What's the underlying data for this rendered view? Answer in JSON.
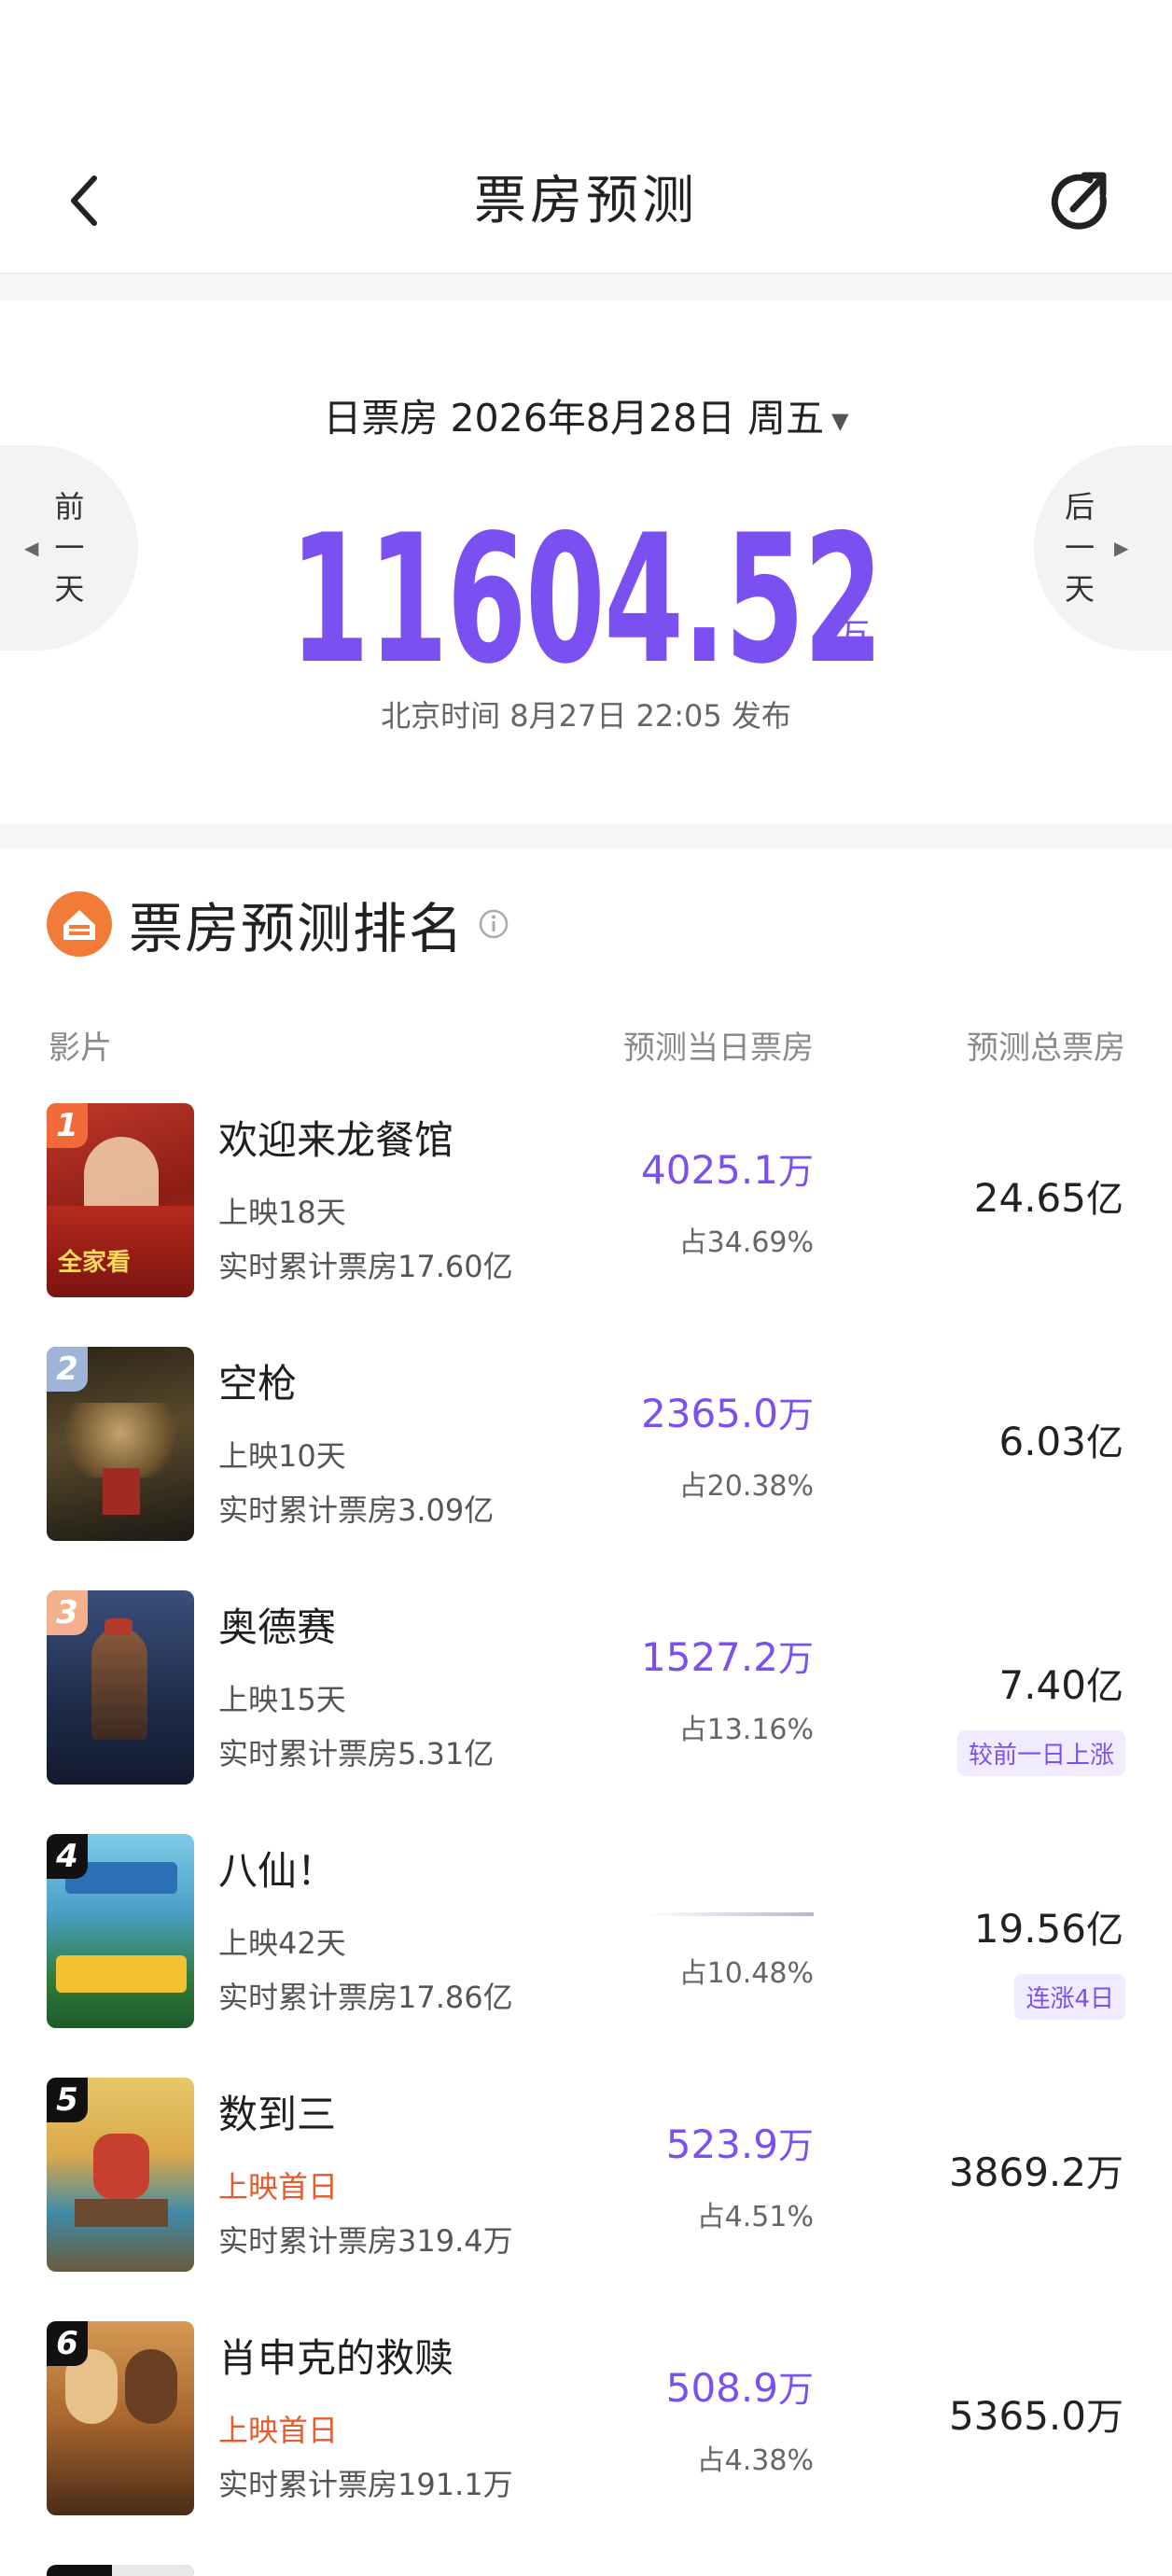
{
  "header": {
    "title": "票房预测"
  },
  "summary": {
    "date_label": "日票房 2026年8月28日 周五",
    "value": "11604.52",
    "unit": "万",
    "publish_note": "北京时间 8月27日 22:05 发布",
    "prev_day_label": [
      "前",
      "一",
      "天"
    ],
    "next_day_label": [
      "后",
      "一",
      "天"
    ]
  },
  "ranking": {
    "heading": "票房预测排名",
    "columns": {
      "film": "影片",
      "daily": "预测当日票房",
      "total": "预测总票房"
    },
    "items": [
      {
        "rank": "1",
        "name": "欢迎来龙餐馆",
        "days": "上映18天",
        "cumulative": "实时累计票房17.60亿",
        "daily": "4025.1",
        "daily_unit": "万",
        "share": "占34.69%",
        "total": "24.65",
        "total_unit": "亿",
        "tag": ""
      },
      {
        "rank": "2",
        "name": "空枪",
        "days": "上映10天",
        "cumulative": "实时累计票房3.09亿",
        "daily": "2365.0",
        "daily_unit": "万",
        "share": "占20.38%",
        "total": "6.03",
        "total_unit": "亿",
        "tag": ""
      },
      {
        "rank": "3",
        "name": "奥德赛",
        "days": "上映15天",
        "cumulative": "实时累计票房5.31亿",
        "daily": "1527.2",
        "daily_unit": "万",
        "share": "占13.16%",
        "total": "7.40",
        "total_unit": "亿",
        "tag": "较前一日上涨"
      },
      {
        "rank": "4",
        "name": "八仙！",
        "days": "上映42天",
        "cumulative": "实时累计票房17.86亿",
        "daily": "",
        "daily_unit": "",
        "share": "占10.48%",
        "total": "19.56",
        "total_unit": "亿",
        "tag": "连涨4日"
      },
      {
        "rank": "5",
        "name": "数到三",
        "days": "上映首日",
        "cumulative": "实时累计票房319.4万",
        "daily": "523.9",
        "daily_unit": "万",
        "share": "占4.51%",
        "total": "3869.2",
        "total_unit": "万",
        "tag": ""
      },
      {
        "rank": "6",
        "name": "肖申克的救赎",
        "days": "上映首日",
        "cumulative": "实时累计票房191.1万",
        "daily": "508.9",
        "daily_unit": "万",
        "share": "占4.38%",
        "total": "5365.0",
        "total_unit": "万",
        "tag": ""
      }
    ]
  },
  "colors": {
    "accent": "#7b4ff0",
    "first_day": "#e55b2d",
    "logo": "#f37b38"
  },
  "icons": [
    "back-arrow-icon",
    "share-refresh-icon",
    "triangle-left-icon",
    "triangle-right-icon",
    "dropdown-caret-icon",
    "ticket-logo-icon",
    "info-icon"
  ]
}
